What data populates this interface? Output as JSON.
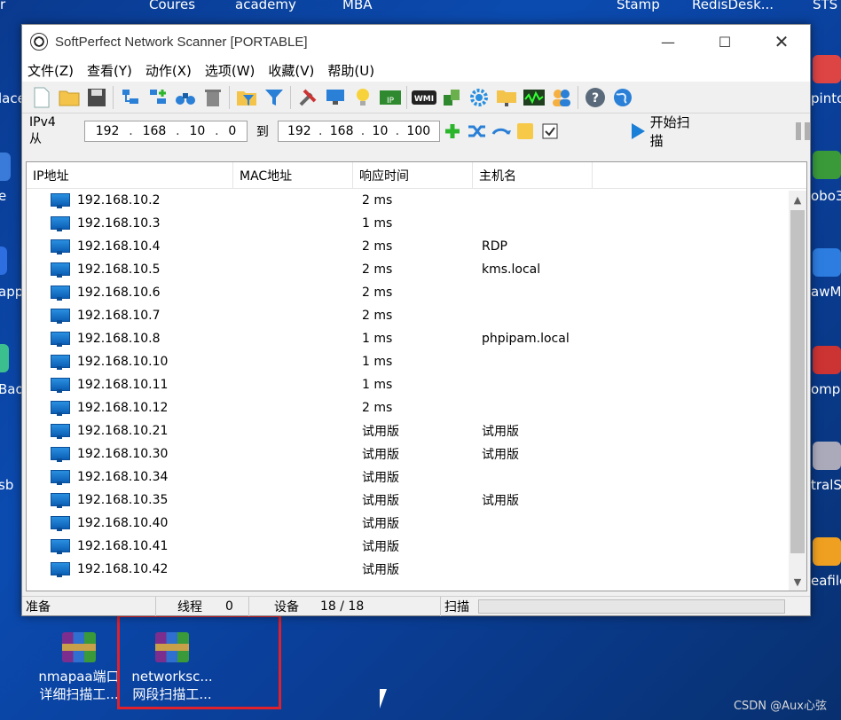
{
  "desktop": {
    "top_labels": [
      "Coures",
      "academy",
      "MBA",
      "Stamp",
      "RedisDesk...",
      "STS"
    ],
    "left_labels": [
      "lace",
      "e",
      "app",
      "Bao",
      "sb"
    ],
    "right_labels": [
      "pinto",
      "obo3",
      "awM",
      "ompa",
      "tralS",
      "eafile"
    ],
    "icons": [
      {
        "line1": "nmapaa端口",
        "line2": "详细扫描工..."
      },
      {
        "line1": "networksc...",
        "line2": "网段扫描工..."
      }
    ],
    "watermark": "CSDN @Aux心弦"
  },
  "window": {
    "title": "SoftPerfect Network Scanner [PORTABLE]",
    "controls": {
      "minimize": "—",
      "maximize": "☐",
      "close": "✕"
    }
  },
  "menu": [
    "文件(Z)",
    "查看(Y)",
    "动作(X)",
    "选项(W)",
    "收藏(V)",
    "帮助(U)"
  ],
  "toolbar": {
    "wmi_label": "WMI",
    "ip_label": "IP"
  },
  "range": {
    "label": "IPv4 从",
    "from": [
      "192",
      "168",
      "10",
      "0"
    ],
    "to_label": "到",
    "to": [
      "192",
      "168",
      "10",
      "100"
    ],
    "start_label": "开始扫描"
  },
  "table": {
    "columns": [
      "IP地址",
      "MAC地址",
      "响应时间",
      "主机名"
    ],
    "rows": [
      {
        "ip": "192.168.10.2",
        "mac": "",
        "rt": "2 ms",
        "host": ""
      },
      {
        "ip": "192.168.10.3",
        "mac": "",
        "rt": "1 ms",
        "host": ""
      },
      {
        "ip": "192.168.10.4",
        "mac": "",
        "rt": "2 ms",
        "host": "RDP"
      },
      {
        "ip": "192.168.10.5",
        "mac": "",
        "rt": "2 ms",
        "host": "kms.local"
      },
      {
        "ip": "192.168.10.6",
        "mac": "",
        "rt": "2 ms",
        "host": ""
      },
      {
        "ip": "192.168.10.7",
        "mac": "",
        "rt": "2 ms",
        "host": ""
      },
      {
        "ip": "192.168.10.8",
        "mac": "",
        "rt": "1 ms",
        "host": "phpipam.local"
      },
      {
        "ip": "192.168.10.10",
        "mac": "",
        "rt": "1 ms",
        "host": ""
      },
      {
        "ip": "192.168.10.11",
        "mac": "",
        "rt": "1 ms",
        "host": ""
      },
      {
        "ip": "192.168.10.12",
        "mac": "",
        "rt": "2 ms",
        "host": ""
      },
      {
        "ip": "192.168.10.21",
        "mac": "",
        "rt": "试用版",
        "host": "试用版"
      },
      {
        "ip": "192.168.10.30",
        "mac": "",
        "rt": "试用版",
        "host": "试用版"
      },
      {
        "ip": "192.168.10.34",
        "mac": "",
        "rt": "试用版",
        "host": ""
      },
      {
        "ip": "192.168.10.35",
        "mac": "",
        "rt": "试用版",
        "host": "试用版"
      },
      {
        "ip": "192.168.10.40",
        "mac": "",
        "rt": "试用版",
        "host": ""
      },
      {
        "ip": "192.168.10.41",
        "mac": "",
        "rt": "试用版",
        "host": ""
      },
      {
        "ip": "192.168.10.42",
        "mac": "",
        "rt": "试用版",
        "host": ""
      }
    ]
  },
  "status": {
    "ready": "准备",
    "threads_label": "线程",
    "threads_value": "0",
    "devices_label": "设备",
    "devices_value": "18 / 18",
    "scan_label": "扫描",
    "scan_progress": 0
  }
}
